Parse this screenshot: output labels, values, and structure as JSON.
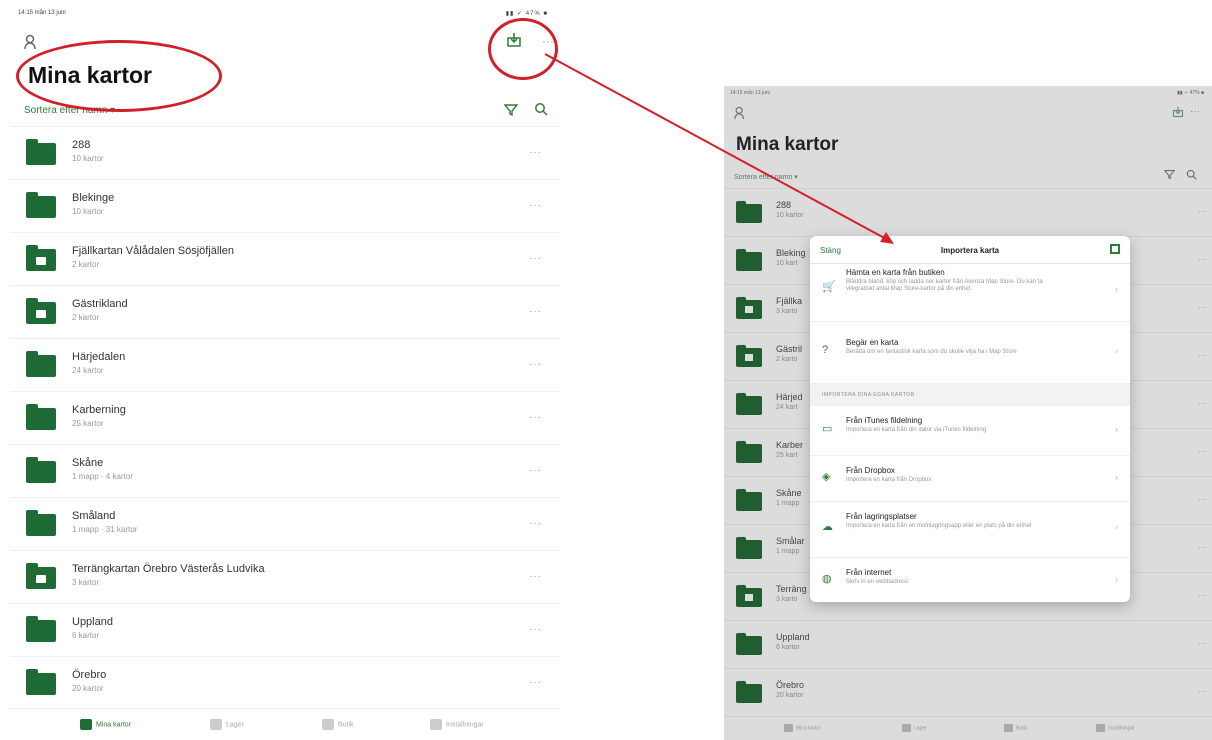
{
  "left": {
    "status_time": "14:15 mån 13 juni",
    "status_right": "▮▮ ✓ 47% ■",
    "title": "Mina kartor",
    "sort_label": "Sortera efter namn ▾",
    "items": [
      {
        "name": "288",
        "sub": "10 kartor",
        "lock": false
      },
      {
        "name": "Blekinge",
        "sub": "10 kartor",
        "lock": false
      },
      {
        "name": "Fjällkartan Vålådalen Sösjöfjällen",
        "sub": "2 kartor",
        "lock": true
      },
      {
        "name": "Gästrikland",
        "sub": "2 kartor",
        "lock": true
      },
      {
        "name": "Härjedalen",
        "sub": "24 kartor",
        "lock": false
      },
      {
        "name": "Karberning",
        "sub": "25 kartor",
        "lock": false
      },
      {
        "name": "Skåne",
        "sub": "1 mapp · 4 kartor",
        "lock": false
      },
      {
        "name": "Småland",
        "sub": "1 mapp · 31 kartor",
        "lock": false
      },
      {
        "name": "Terrängkartan Örebro Västerås Ludvika",
        "sub": "3 kartor",
        "lock": true
      },
      {
        "name": "Uppland",
        "sub": "6 kartor",
        "lock": false
      },
      {
        "name": "Örebro",
        "sub": "20 kartor",
        "lock": false
      }
    ],
    "tabs": [
      "Mina kartor",
      "Lager",
      "Butik",
      "Inställningar"
    ]
  },
  "right": {
    "status_time": "14:15 mån 13 juni",
    "status_right": "▮▮ ✓ 47% ■",
    "title": "Mina kartor",
    "sort_label": "Sortera efter namn ▾",
    "items": [
      {
        "name": "288",
        "sub": "10 kartor",
        "lock": false
      },
      {
        "name": "Bleking",
        "sub": "10 kart",
        "lock": false
      },
      {
        "name": "Fjällka",
        "sub": "3 karto",
        "lock": true
      },
      {
        "name": "Gästril",
        "sub": "2 karto",
        "lock": true
      },
      {
        "name": "Härjed",
        "sub": "24 kart",
        "lock": false
      },
      {
        "name": "Karber",
        "sub": "25 kart",
        "lock": false
      },
      {
        "name": "Skåne",
        "sub": "1 mapp",
        "lock": false
      },
      {
        "name": "Smålar",
        "sub": "1 mapp",
        "lock": false
      },
      {
        "name": "Terräng",
        "sub": "3 karto",
        "lock": true
      },
      {
        "name": "Uppland",
        "sub": "6 kartor",
        "lock": false
      },
      {
        "name": "Örebro",
        "sub": "20 kartor",
        "lock": false
      }
    ],
    "tabs": [
      "Mina kartor",
      "Lager",
      "Butik",
      "Inställningar"
    ]
  },
  "modal": {
    "close": "Stäng",
    "title": "Importera karta",
    "items": [
      {
        "name": "Hämta en karta från butiken",
        "desc": "Bläddra bland, köp och ladda ner kartor från Avenza Map Store. Du kan ta vilegratiskt antal Map Store-kartor på din enhet.",
        "icon": "cart-icon",
        "glyph": "🛒"
      },
      {
        "name": "Begär en karta",
        "desc": "Berätta om en fantastisk karta som du skulle vilja ha i Map Store",
        "icon": "question-icon",
        "glyph": "?"
      },
      {
        "name": "Från iTunes fildelning",
        "desc": "Importera en karta från din dator via iTunes fildelning",
        "icon": "folder-icon",
        "glyph": "▭"
      },
      {
        "name": "Från Dropbox",
        "desc": "Importera en karta från Dropbox",
        "icon": "dropbox-icon",
        "glyph": "◈"
      },
      {
        "name": "Från lagringsplatser",
        "desc": "Importera en karta från en molnlagringsapp eller en plats på din enhet",
        "icon": "cloud-icon",
        "glyph": "☁"
      },
      {
        "name": "Från internet",
        "desc": "Skriv in en webbadress",
        "icon": "globe-icon",
        "glyph": "◍"
      }
    ],
    "section": "IMPORTERA DINA EGNA KARTOR"
  },
  "colors": {
    "accent": "#2e7d3a",
    "annotation": "#d21f2a"
  }
}
